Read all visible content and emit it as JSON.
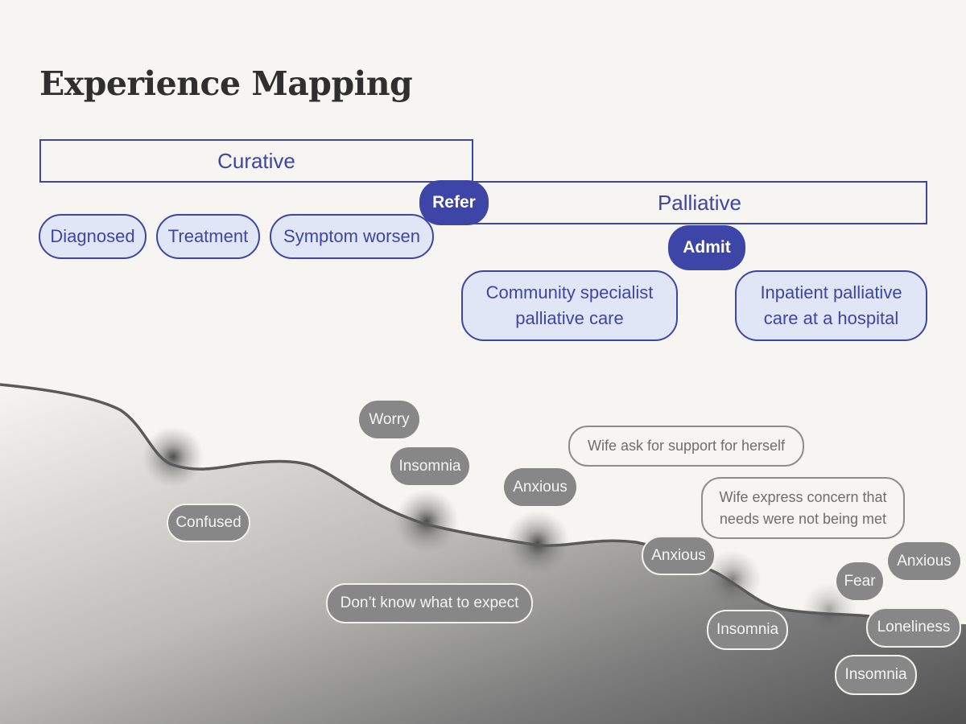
{
  "title": "Experience Mapping",
  "phases": {
    "curative": "Curative",
    "palliative": "Palliative"
  },
  "stages": {
    "diagnosed": "Diagnosed",
    "treatment": "Treatment",
    "symptom_worsen": "Symptom worsen",
    "community_line1": "Community specialist",
    "community_line2": "palliative care",
    "inpatient_line1": "Inpatient palliative",
    "inpatient_line2": "care at a hospital"
  },
  "actions": {
    "refer": "Refer",
    "admit": "Admit"
  },
  "colors": {
    "accent": "#3d45a6",
    "stage_fill": "#e1e6f6",
    "tag_fill": "#878787",
    "curve": "#5a5a5a",
    "background": "#f6f5f1"
  },
  "emotions": [
    {
      "label": "Confused"
    },
    {
      "label": "Worry"
    },
    {
      "label": "Insomnia"
    },
    {
      "label": "Anxious"
    },
    {
      "label": "Don’t know what to expect"
    },
    {
      "label": "Anxious"
    },
    {
      "label": "Insomnia"
    },
    {
      "label": "Fear"
    },
    {
      "label": "Anxious"
    },
    {
      "label": "Loneliness"
    },
    {
      "label": "Insomnia"
    }
  ],
  "notes": {
    "wife_support": "Wife ask for support for herself",
    "wife_concern_line1": "Wife express concern that",
    "wife_concern_line2": "needs were not being met"
  }
}
